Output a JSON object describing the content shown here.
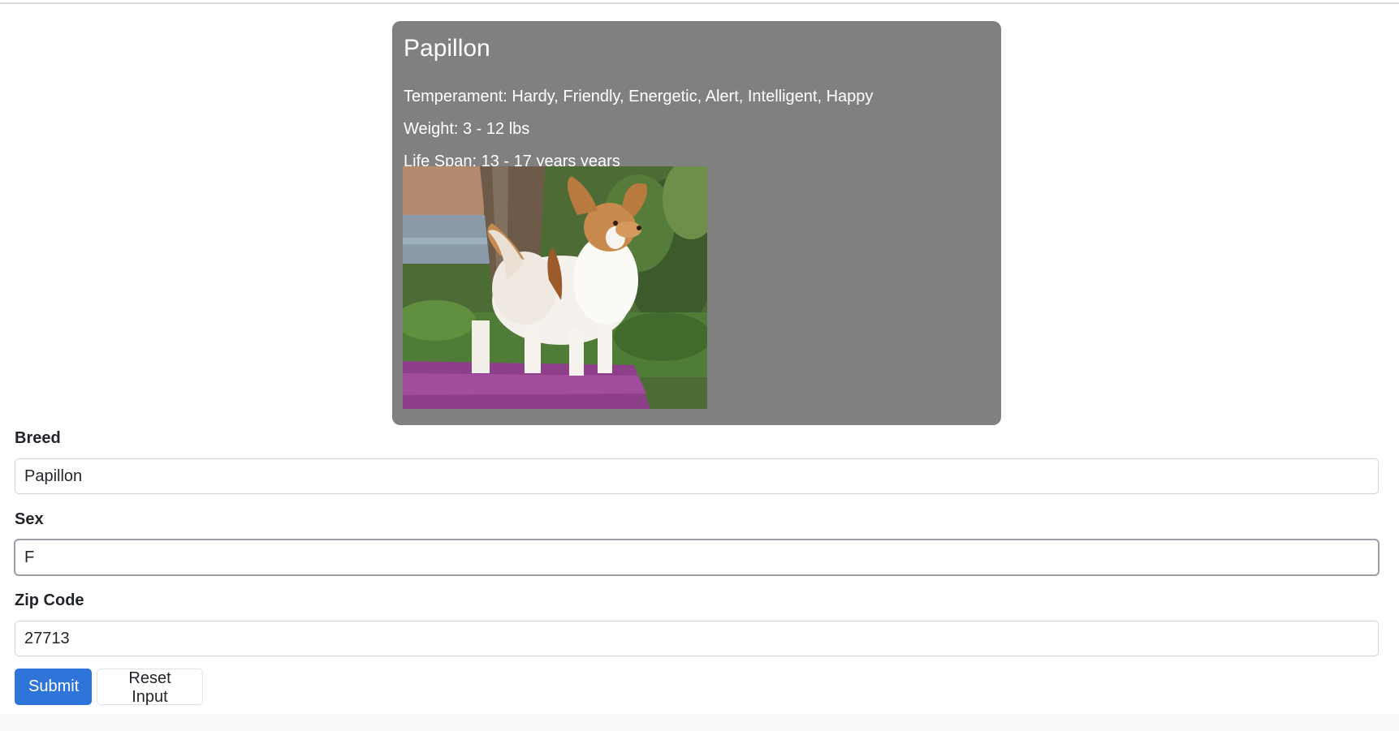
{
  "card": {
    "title": "Papillon",
    "temperament": "Temperament: Hardy, Friendly, Energetic, Alert, Intelligent, Happy",
    "weight": "Weight: 3 - 12 lbs",
    "life_span": "Life Span: 13 - 17 years years",
    "background_color": "#808080"
  },
  "form": {
    "breed_label": "Breed",
    "breed_value": "Papillon",
    "sex_label": "Sex",
    "sex_value": "F",
    "zip_label": "Zip Code",
    "zip_value": "27713"
  },
  "buttons": {
    "submit_label": "Submit",
    "reset_label": "Reset Input",
    "primary_color": "#2f74d8"
  }
}
